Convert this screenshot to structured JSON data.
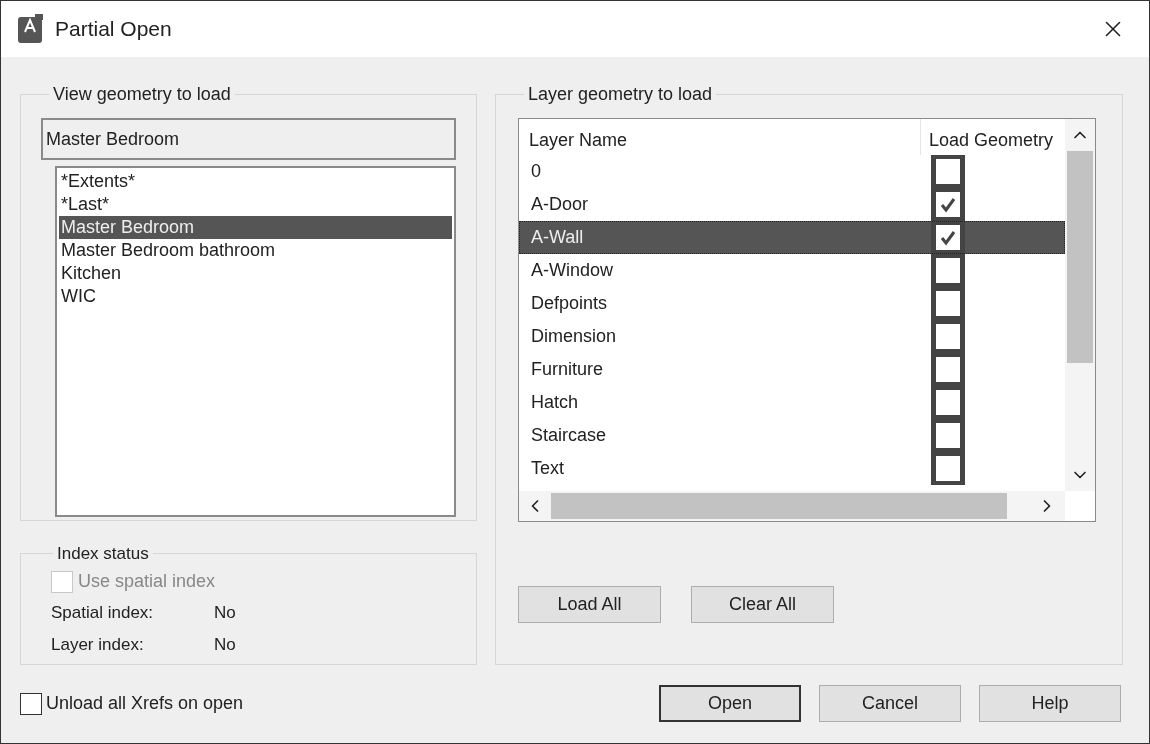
{
  "window": {
    "title": "Partial Open"
  },
  "view_group": {
    "title": "View geometry to load",
    "field_value": "Master Bedroom",
    "views": [
      {
        "label": "*Extents*",
        "selected": false
      },
      {
        "label": "*Last*",
        "selected": false
      },
      {
        "label": "Master Bedroom",
        "selected": true
      },
      {
        "label": "Master Bedroom bathroom",
        "selected": false
      },
      {
        "label": "Kitchen",
        "selected": false
      },
      {
        "label": "WIC",
        "selected": false
      }
    ]
  },
  "index_group": {
    "title": "Index status",
    "use_spatial_index": {
      "label": "Use spatial index",
      "checked": false,
      "disabled": true
    },
    "rows": [
      {
        "label": "Spatial index:",
        "value": "No"
      },
      {
        "label": "Layer index:",
        "value": "No"
      }
    ]
  },
  "layer_group": {
    "title": "Layer geometry to load",
    "columns": [
      "Layer Name",
      "Load Geometry"
    ],
    "layers": [
      {
        "name": "0",
        "checked": false,
        "selected": false
      },
      {
        "name": "A-Door",
        "checked": true,
        "selected": false
      },
      {
        "name": "A-Wall",
        "checked": true,
        "selected": true
      },
      {
        "name": "A-Window",
        "checked": false,
        "selected": false
      },
      {
        "name": "Defpoints",
        "checked": false,
        "selected": false
      },
      {
        "name": "Dimension",
        "checked": false,
        "selected": false
      },
      {
        "name": "Furniture",
        "checked": false,
        "selected": false
      },
      {
        "name": "Hatch",
        "checked": false,
        "selected": false
      },
      {
        "name": "Staircase",
        "checked": false,
        "selected": false
      },
      {
        "name": "Text",
        "checked": false,
        "selected": false
      }
    ],
    "buttons": [
      "Load All",
      "Clear All"
    ]
  },
  "unload_xrefs": {
    "label": "Unload all Xrefs on open",
    "checked": false
  },
  "buttons": [
    {
      "label": "Open",
      "default": true
    },
    {
      "label": "Cancel",
      "default": false
    },
    {
      "label": "Help",
      "default": false
    }
  ]
}
